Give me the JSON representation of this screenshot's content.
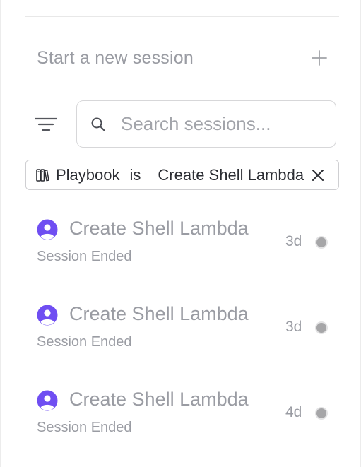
{
  "new_session": {
    "label": "Start a new session",
    "icon": "plus-icon"
  },
  "filter": {
    "icon": "filter-icon"
  },
  "search": {
    "placeholder": "Search sessions...",
    "value": "",
    "icon": "search-icon"
  },
  "active_filter": {
    "icon": "playbook-icon",
    "field": "Playbook",
    "operator": "is",
    "value": "Create Shell Lambda",
    "close_icon": "close-icon"
  },
  "sessions": [
    {
      "title": "Create Shell Lambda",
      "status": "Session Ended",
      "age": "3d"
    },
    {
      "title": "Create Shell Lambda",
      "status": "Session Ended",
      "age": "3d"
    },
    {
      "title": "Create Shell Lambda",
      "status": "Session Ended",
      "age": "4d"
    }
  ],
  "colors": {
    "avatar_accent": "#6f4ef2",
    "muted_text": "#9a9ca3",
    "status_dot": "#a6a6a8"
  }
}
